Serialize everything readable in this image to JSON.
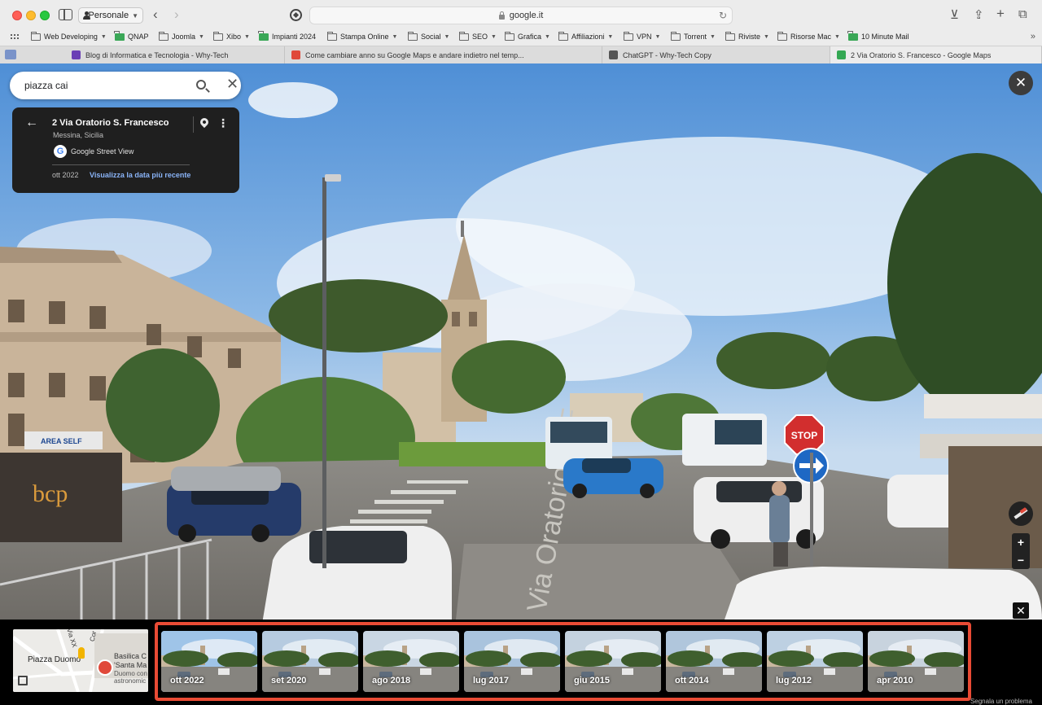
{
  "browser": {
    "profile": "Personale",
    "url": "google.it",
    "bookmarks": [
      {
        "label": "Web Developing",
        "folder": true
      },
      {
        "label": "QNAP",
        "folder": false
      },
      {
        "label": "Joomla",
        "folder": true
      },
      {
        "label": "Xibo",
        "folder": true
      },
      {
        "label": "Impianti 2024",
        "folder": false
      },
      {
        "label": "Stampa Online",
        "folder": true
      },
      {
        "label": "Social",
        "folder": true
      },
      {
        "label": "SEO",
        "folder": true
      },
      {
        "label": "Grafica",
        "folder": true
      },
      {
        "label": "Affiliazioni",
        "folder": true
      },
      {
        "label": "VPN",
        "folder": true
      },
      {
        "label": "Torrent",
        "folder": true
      },
      {
        "label": "Riviste",
        "folder": true
      },
      {
        "label": "Risorse Mac",
        "folder": true
      },
      {
        "label": "10 Minute Mail",
        "folder": false
      }
    ],
    "tabs": [
      {
        "title": "Blog di Informatica e Tecnologia - Why-Tech",
        "favicon_color": "#6a3fb5"
      },
      {
        "title": "Come cambiare anno su Google Maps e andare indietro nel temp...",
        "favicon_color": "#e0493a"
      },
      {
        "title": "ChatGPT - Why-Tech Copy",
        "favicon_color": "#555555"
      },
      {
        "title": "2 Via Oratorio S. Francesco - Google Maps",
        "favicon_color": "#34a853"
      }
    ]
  },
  "search": {
    "query": "piazza cai"
  },
  "place_card": {
    "title": "2 Via Oratorio S. Francesco",
    "subtitle": "Messina, Sicilia",
    "source": "Google Street View",
    "google_letter": "G",
    "date": "ott 2022",
    "recent_link": "Visualizza la data più recente"
  },
  "controls": {
    "close": "✕",
    "zoom_in": "+",
    "zoom_out": "−"
  },
  "minimap": {
    "labels": [
      "Piazza Duomo",
      "Basilica C",
      "'Santa Ma",
      "Duomo con",
      "astronomic",
      "Via XX",
      "Cor"
    ]
  },
  "timeline": [
    {
      "date": "ott 2022",
      "selected": true
    },
    {
      "date": "set 2020",
      "selected": false
    },
    {
      "date": "ago 2018",
      "selected": false
    },
    {
      "date": "lug 2017",
      "selected": false
    },
    {
      "date": "giu 2015",
      "selected": false
    },
    {
      "date": "ott 2014",
      "selected": false
    },
    {
      "date": "lug 2012",
      "selected": false
    },
    {
      "date": "apr 2010",
      "selected": false
    }
  ],
  "footer": {
    "report": "Segnala un problema"
  },
  "colors": {
    "highlight_frame": "#e94b35",
    "link": "#8ab4f8",
    "card_bg": "#1f1f1f"
  }
}
